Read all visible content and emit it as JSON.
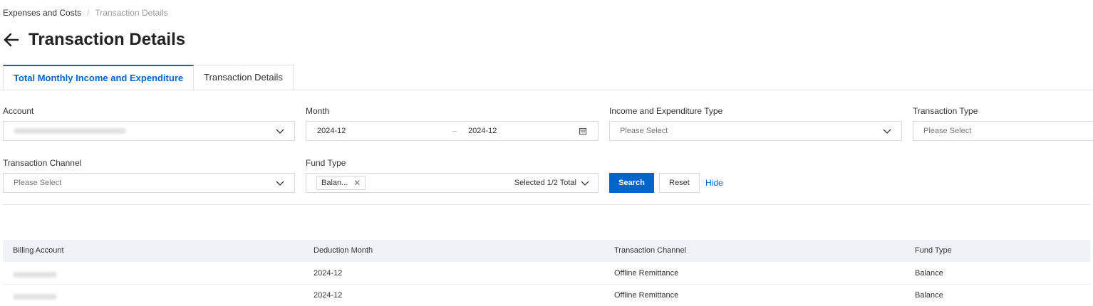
{
  "breadcrumb": {
    "parent": "Expenses and Costs",
    "separator": "/",
    "current": "Transaction Details"
  },
  "page": {
    "title": "Transaction Details"
  },
  "tabs": [
    {
      "label": "Total Monthly Income and Expenditure",
      "active": true
    },
    {
      "label": "Transaction Details",
      "active": false
    }
  ],
  "filters": {
    "account": {
      "label": "Account"
    },
    "month": {
      "label": "Month",
      "start": "2024-12",
      "end": "2024-12"
    },
    "income_type": {
      "label": "Income and Expenditure Type",
      "placeholder": "Please Select"
    },
    "transaction_type": {
      "label": "Transaction Type",
      "placeholder": "Please Select"
    },
    "transaction_channel": {
      "label": "Transaction Channel",
      "placeholder": "Please Select"
    },
    "fund_type": {
      "label": "Fund Type",
      "tag": "Balan...",
      "selected_count": "Selected 1/2 Total"
    }
  },
  "actions": {
    "search": "Search",
    "reset": "Reset",
    "hide": "Hide"
  },
  "table": {
    "columns": [
      "Billing Account",
      "Deduction Month",
      "Transaction Channel",
      "Fund Type"
    ],
    "rows": [
      {
        "month": "2024-12",
        "channel": "Offline Remittance",
        "fund": "Balance"
      },
      {
        "month": "2024-12",
        "channel": "Offline Remittance",
        "fund": "Balance"
      }
    ]
  },
  "colors": {
    "primary": "#0064c8",
    "header_bg": "#eff3f8",
    "border": "#d8d8d8"
  }
}
